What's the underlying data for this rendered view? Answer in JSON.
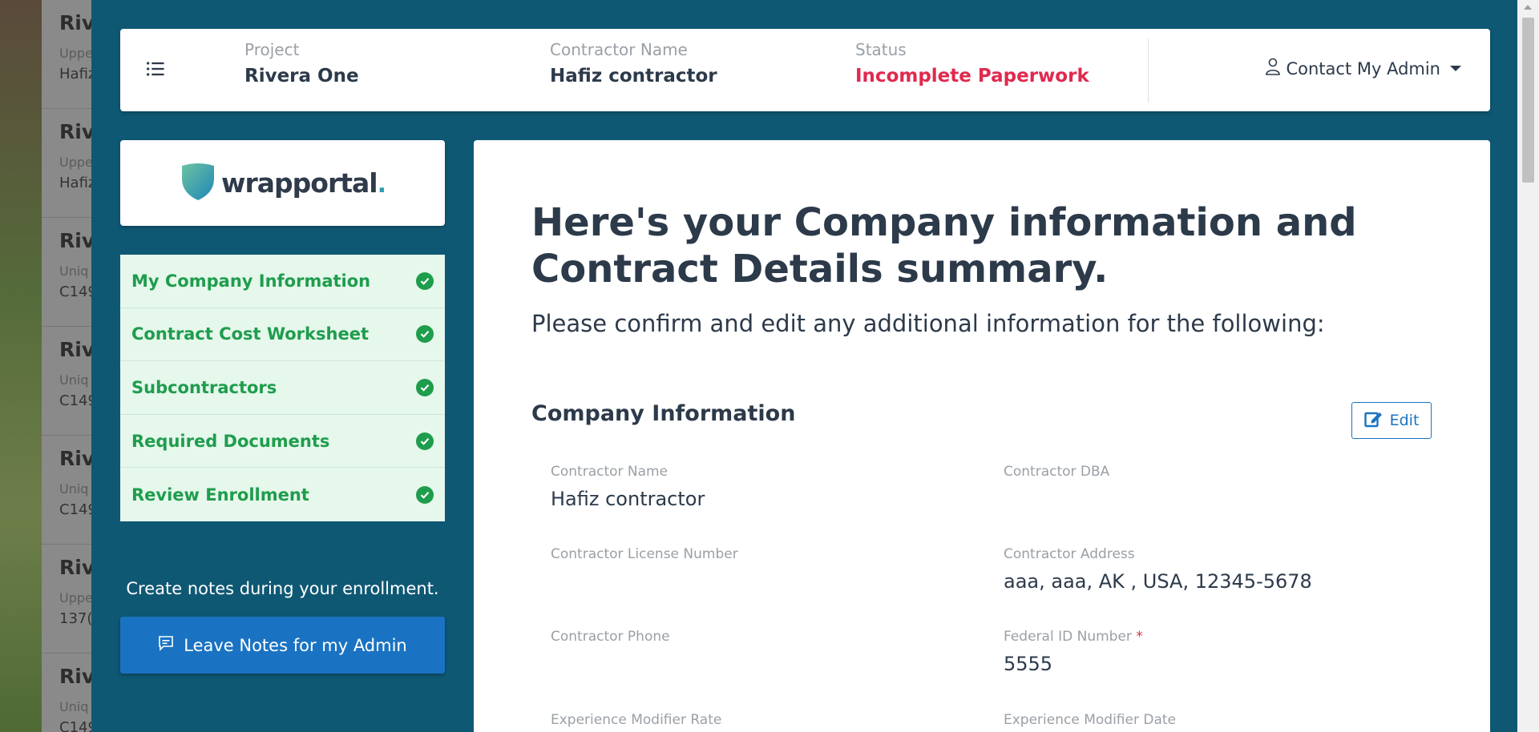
{
  "background_list": [
    {
      "title": "Riv",
      "sub": "Uppe",
      "value": "Hafiz"
    },
    {
      "title": "Riv",
      "sub": "Uppe",
      "value": "Hafiz"
    },
    {
      "title": "Riv",
      "sub": "Uniq",
      "value": "C149"
    },
    {
      "title": "Riv",
      "sub": "Uniq",
      "value": "C149"
    },
    {
      "title": "Riv",
      "sub": "Uniq",
      "value": "C149"
    },
    {
      "title": "Riv",
      "sub": "Uppe",
      "value": "137("
    },
    {
      "title": "Riv",
      "sub": "Uniq",
      "value": "C149"
    }
  ],
  "header": {
    "project_label": "Project",
    "project_value": "Rivera One",
    "contractor_label": "Contractor Name",
    "contractor_value": "Hafiz contractor",
    "status_label": "Status",
    "status_value": "Incomplete Paperwork",
    "contact_admin": "Contact My Admin"
  },
  "logo": {
    "text": "wrapportal",
    "dot": "."
  },
  "steps": [
    {
      "label": "My Company Information",
      "complete": true
    },
    {
      "label": "Contract Cost Worksheet",
      "complete": true
    },
    {
      "label": "Subcontractors",
      "complete": true
    },
    {
      "label": "Required Documents",
      "complete": true
    },
    {
      "label": "Review Enrollment",
      "complete": true
    }
  ],
  "notes": {
    "prompt": "Create notes during your enrollment.",
    "button": "Leave Notes for my Admin"
  },
  "main": {
    "heading": "Here's your Company information and Contract Details summary.",
    "subtitle": "Please confirm and edit any additional information for the following:",
    "section_title": "Company Information",
    "edit_label": "Edit",
    "fields": {
      "contractor_name": {
        "label": "Contractor Name",
        "value": "Hafiz contractor"
      },
      "contractor_dba": {
        "label": "Contractor DBA",
        "value": ""
      },
      "license_number": {
        "label": "Contractor License Number",
        "value": ""
      },
      "address": {
        "label": "Contractor Address",
        "value": "aaa, aaa, AK , USA, 12345-5678"
      },
      "phone": {
        "label": "Contractor Phone",
        "value": ""
      },
      "federal_id": {
        "label": "Federal ID Number",
        "required": "*",
        "value": "5555"
      },
      "exp_mod_rate": {
        "label": "Experience Modifier Rate",
        "value": ""
      },
      "exp_mod_date": {
        "label": "Experience Modifier Date",
        "value": ""
      }
    }
  },
  "colors": {
    "modal_bg": "#0f5874",
    "accent": "#1a73c2",
    "status_red": "#e0294e",
    "step_green": "#1e9d4c",
    "step_bg": "#e6f7ec"
  }
}
